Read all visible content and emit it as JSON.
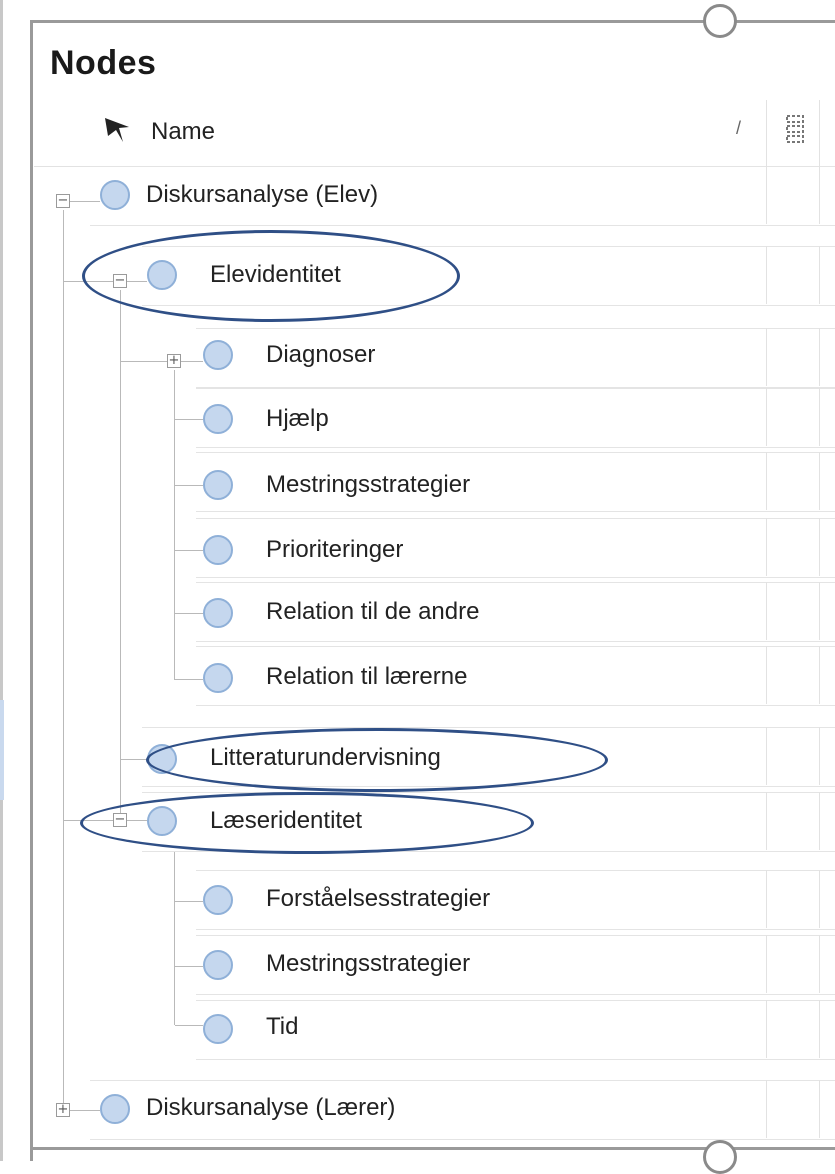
{
  "panel": {
    "title": "Nodes"
  },
  "header": {
    "name_label": "Name",
    "sort_glyph": "/",
    "pin_icon": "pin-icon",
    "files_icon": "files-icon"
  },
  "tree": [
    {
      "label": "Diskursanalyse (Elev)",
      "expander": "−"
    },
    {
      "label": "Elevidentitet",
      "expander": "−"
    },
    {
      "label": "Diagnoser",
      "expander": "+"
    },
    {
      "label": "Hjælp"
    },
    {
      "label": "Mestringsstrategier"
    },
    {
      "label": "Prioriteringer"
    },
    {
      "label": "Relation til de andre"
    },
    {
      "label": "Relation til lærerne"
    },
    {
      "label": "Litteraturundervisning"
    },
    {
      "label": "Læseridentitet",
      "expander": "−"
    },
    {
      "label": "Forståelsesstrategier"
    },
    {
      "label": "Mestringsstrategier"
    },
    {
      "label": "Tid"
    },
    {
      "label": "Diskursanalyse (Lærer)",
      "expander": "+"
    }
  ],
  "colors": {
    "node_fill": "#c5d7ee",
    "node_border": "#8fb0d8",
    "highlight": "#2f4f86"
  }
}
